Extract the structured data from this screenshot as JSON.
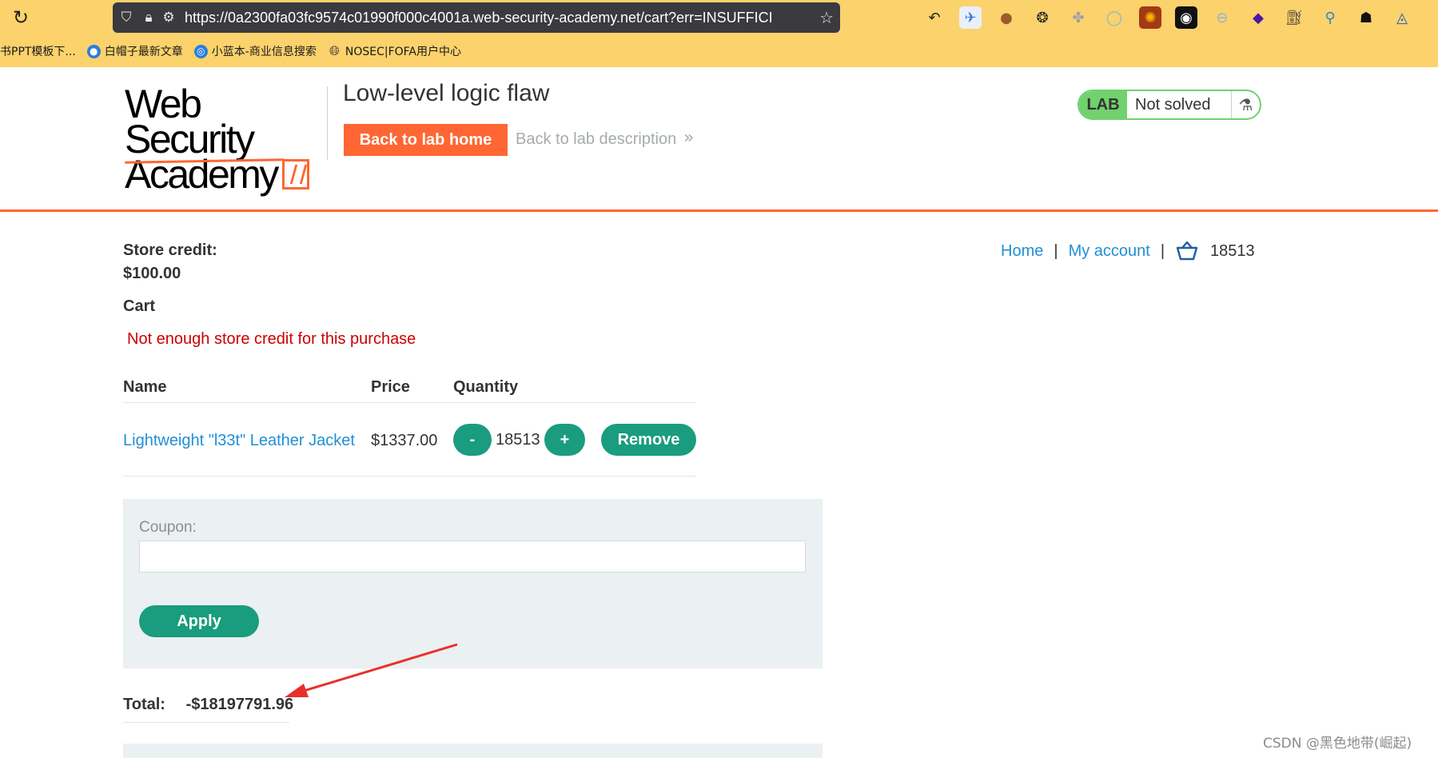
{
  "browser": {
    "url": "https://0a2300fa03fc9574c01990f000c4001a.web-security-academy.net/cart?err=INSUFFICI",
    "bookmarks": [
      {
        "label": "书PPT模板下...",
        "color": "#e8443b"
      },
      {
        "label": "白帽子最新文章",
        "color": "#2a7de1"
      },
      {
        "label": "小蓝本-商业信息搜索",
        "color": "#2a7de1"
      },
      {
        "label": "NOSEC|FOFA用户中心",
        "color": "#333333"
      }
    ],
    "extension_icons": [
      "undo-icon",
      "bird-icon",
      "cookie-icon",
      "cookie-outline-icon",
      "puzzle-icon",
      "ring-icon",
      "gear-icon",
      "mask-icon",
      "toggle-icon",
      "diamond-icon",
      "hat-icon",
      "pin-icon",
      "spy-icon",
      "triangle-icon"
    ]
  },
  "lab_header": {
    "logo_line1": "Web Security",
    "logo_line2": "Academy",
    "title": "Low-level logic flaw",
    "back_home_label": "Back to lab home",
    "back_description_label": "Back to lab description",
    "status_badge": "LAB",
    "status_text": "Not solved",
    "accent_color": "#ff6633",
    "badge_color": "#70d16d"
  },
  "nav": {
    "home_label": "Home",
    "separator": "|",
    "account_label": "My account",
    "cart_count": "18513"
  },
  "store_credit": {
    "label": "Store credit:",
    "value": "$100.00"
  },
  "cart": {
    "title": "Cart",
    "error": "Not enough store credit for this purchase",
    "columns": [
      "Name",
      "Price",
      "Quantity"
    ],
    "items": [
      {
        "name": "Lightweight \"l33t\" Leather Jacket",
        "price": "$1337.00",
        "quantity": "18513",
        "decrement_label": "-",
        "increment_label": "+",
        "remove_label": "Remove"
      }
    ],
    "button_color": "#1a9c7e"
  },
  "coupon": {
    "label": "Coupon:",
    "value": "",
    "apply_label": "Apply"
  },
  "total": {
    "label": "Total:",
    "value": "-$18197791.96"
  },
  "watermark": "CSDN @黑色地带(崛起)"
}
